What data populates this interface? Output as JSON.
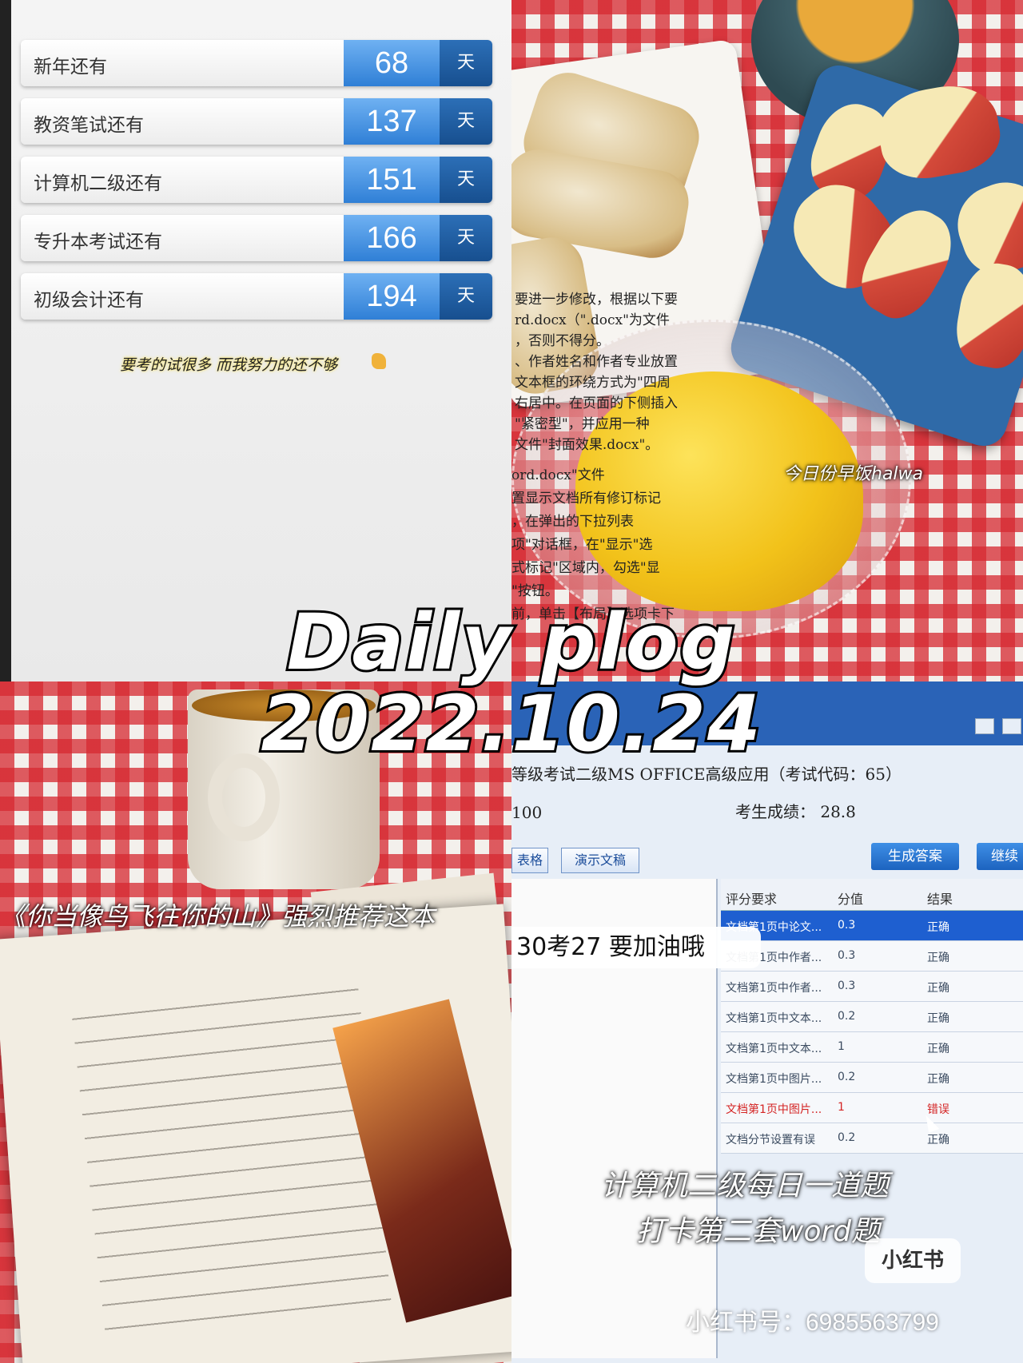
{
  "countdown": {
    "items": [
      {
        "label": "新年还有",
        "days": "68",
        "unit": "天"
      },
      {
        "label": "教资笔试还有",
        "days": "137",
        "unit": "天"
      },
      {
        "label": "计算机二级还有",
        "days": "151",
        "unit": "天"
      },
      {
        "label": "专升本考试还有",
        "days": "166",
        "unit": "天"
      },
      {
        "label": "初级会计还有",
        "days": "194",
        "unit": "天"
      }
    ],
    "motto": "要考的试很多 而我努力的还不够"
  },
  "breakfast": {
    "caption": "今日份早饭halwa"
  },
  "title": {
    "line1": "Daily plog",
    "line2": "2022.10.24"
  },
  "book": {
    "caption": "《你当像鸟飞往你的山》强烈推荐这本"
  },
  "exam": {
    "title": "等级考试二级MS OFFICE高级应用（考试代码：65）",
    "full_score": "100",
    "score_label": "考生成绩：",
    "score": "28.8",
    "tabs": [
      "表格",
      "演示文稿"
    ],
    "btn_generate": "生成答案",
    "btn_continue": "继续",
    "grid_headers": [
      "评分要求",
      "分值",
      "结果"
    ],
    "grid_rows": [
      {
        "req": "文档第1页中论文...",
        "score": "0.3",
        "result": "正确"
      },
      {
        "req": "文档第1页中作者...",
        "score": "0.3",
        "result": "正确"
      },
      {
        "req": "文档第1页中作者...",
        "score": "0.3",
        "result": "正确"
      },
      {
        "req": "文档第1页中文本...",
        "score": "0.2",
        "result": "正确"
      },
      {
        "req": "文档第1页中文本...",
        "score": "1",
        "result": "正确"
      },
      {
        "req": "文档第1页中图片...",
        "score": "0.2",
        "result": "正确"
      },
      {
        "req": "文档第1页中图片...",
        "score": "1",
        "result": "错误"
      },
      {
        "req": "文档分节设置有误",
        "score": "0.2",
        "result": "正确"
      }
    ],
    "left_text": "要进一步修改，根据以下要\nrd.docx（\".docx\"为文件\n，否则不得分。\n、作者姓名和作者专业放置\n文本框的环绕方式为\"四周\n右居中。在页面的下侧插入\n\"紧密型\"，并应用一种\n文件\"封面效果.docx\"。",
    "left_text2": "ord.docx\"文件\n置显示文档所有修订标记\n，在弹出的下拉列表\n项\"对话框，在\"显示\"选\n式标记\"区域内，勾选\"显\n\"按钮。\n前，单击【布局】选项卡下",
    "note": "30考27 要加油哦",
    "caption1": "计算机二级每日一道题",
    "caption2": "打卡第二套word题",
    "logo": "小红书",
    "xhs_id": "小红书号：6985563799"
  }
}
